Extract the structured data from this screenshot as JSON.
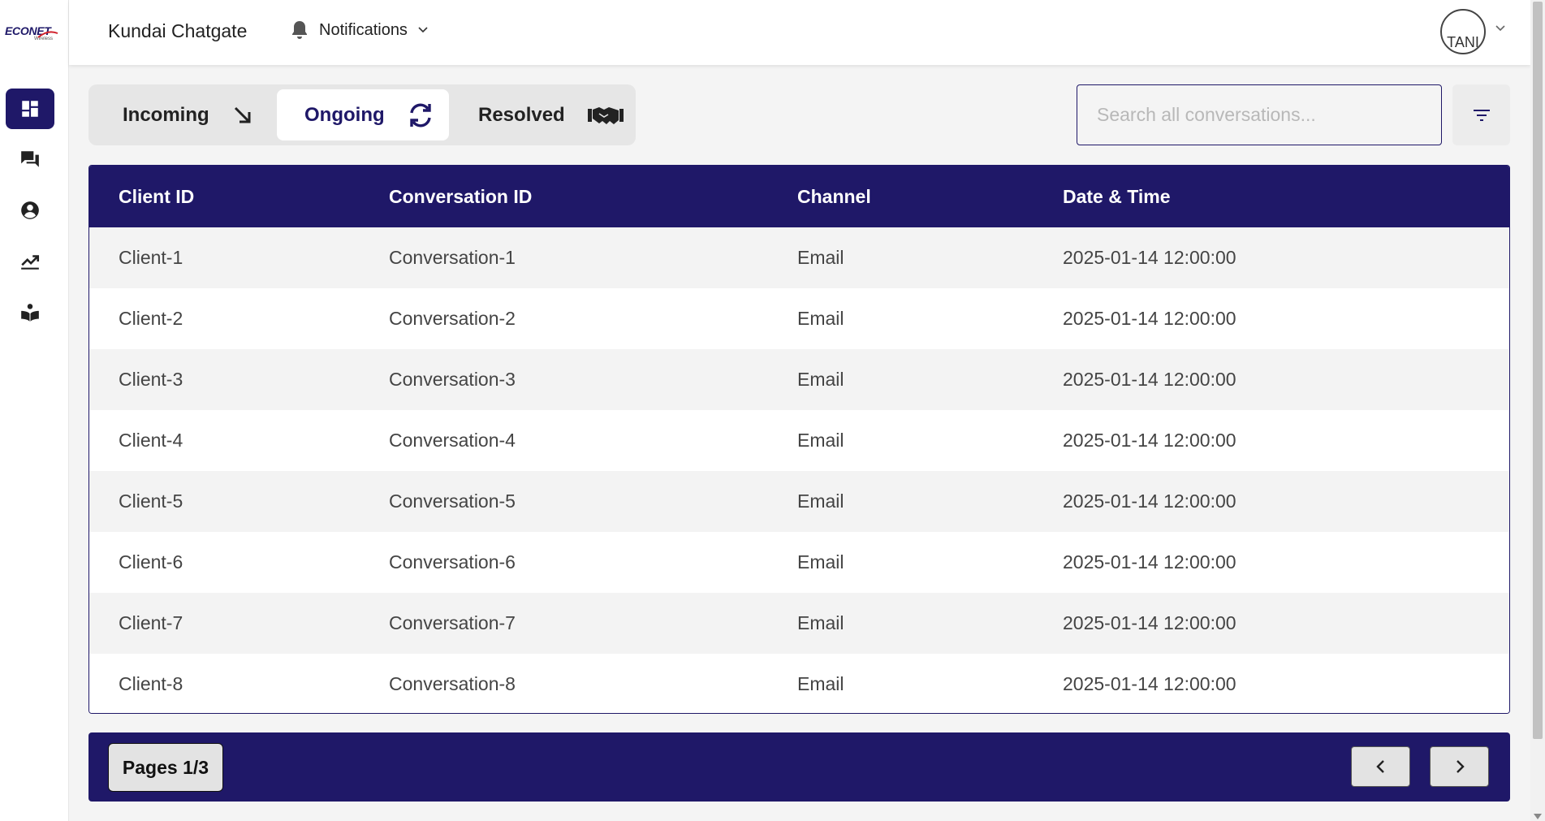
{
  "brand": {
    "logo_text": "ECONET",
    "logo_sub": "Wireless"
  },
  "header": {
    "title": "Kundai Chatgate",
    "notifications_label": "Notifications",
    "avatar_alt": "TANI"
  },
  "sidebar": {
    "items": [
      {
        "name": "dashboard",
        "icon": "dashboard-icon",
        "active": true
      },
      {
        "name": "chats",
        "icon": "chat-bubbles-icon",
        "active": false
      },
      {
        "name": "profile",
        "icon": "user-circle-icon",
        "active": false
      },
      {
        "name": "analytics",
        "icon": "trending-up-icon",
        "active": false
      },
      {
        "name": "knowledge-base",
        "icon": "book-reader-icon",
        "active": false
      }
    ]
  },
  "tabs": [
    {
      "label": "Incoming",
      "icon": "arrow-down-right-icon",
      "active": false
    },
    {
      "label": "Ongoing",
      "icon": "refresh-icon",
      "active": true
    },
    {
      "label": "Resolved",
      "icon": "handshake-icon",
      "active": false
    }
  ],
  "search": {
    "placeholder": "Search all conversations...",
    "value": ""
  },
  "table": {
    "headers": [
      "Client ID",
      "Conversation ID",
      "Channel",
      "Date & Time"
    ],
    "rows": [
      [
        "Client-1",
        "Conversation-1",
        "Email",
        "2025-01-14 12:00:00"
      ],
      [
        "Client-2",
        "Conversation-2",
        "Email",
        "2025-01-14 12:00:00"
      ],
      [
        "Client-3",
        "Conversation-3",
        "Email",
        "2025-01-14 12:00:00"
      ],
      [
        "Client-4",
        "Conversation-4",
        "Email",
        "2025-01-14 12:00:00"
      ],
      [
        "Client-5",
        "Conversation-5",
        "Email",
        "2025-01-14 12:00:00"
      ],
      [
        "Client-6",
        "Conversation-6",
        "Email",
        "2025-01-14 12:00:00"
      ],
      [
        "Client-7",
        "Conversation-7",
        "Email",
        "2025-01-14 12:00:00"
      ],
      [
        "Client-8",
        "Conversation-8",
        "Email",
        "2025-01-14 12:00:00"
      ]
    ]
  },
  "pagination": {
    "label": "Pages 1/3"
  },
  "colors": {
    "primary": "#1f1868",
    "row_alt": "#f3f3f3",
    "background": "#f4f4f4"
  }
}
